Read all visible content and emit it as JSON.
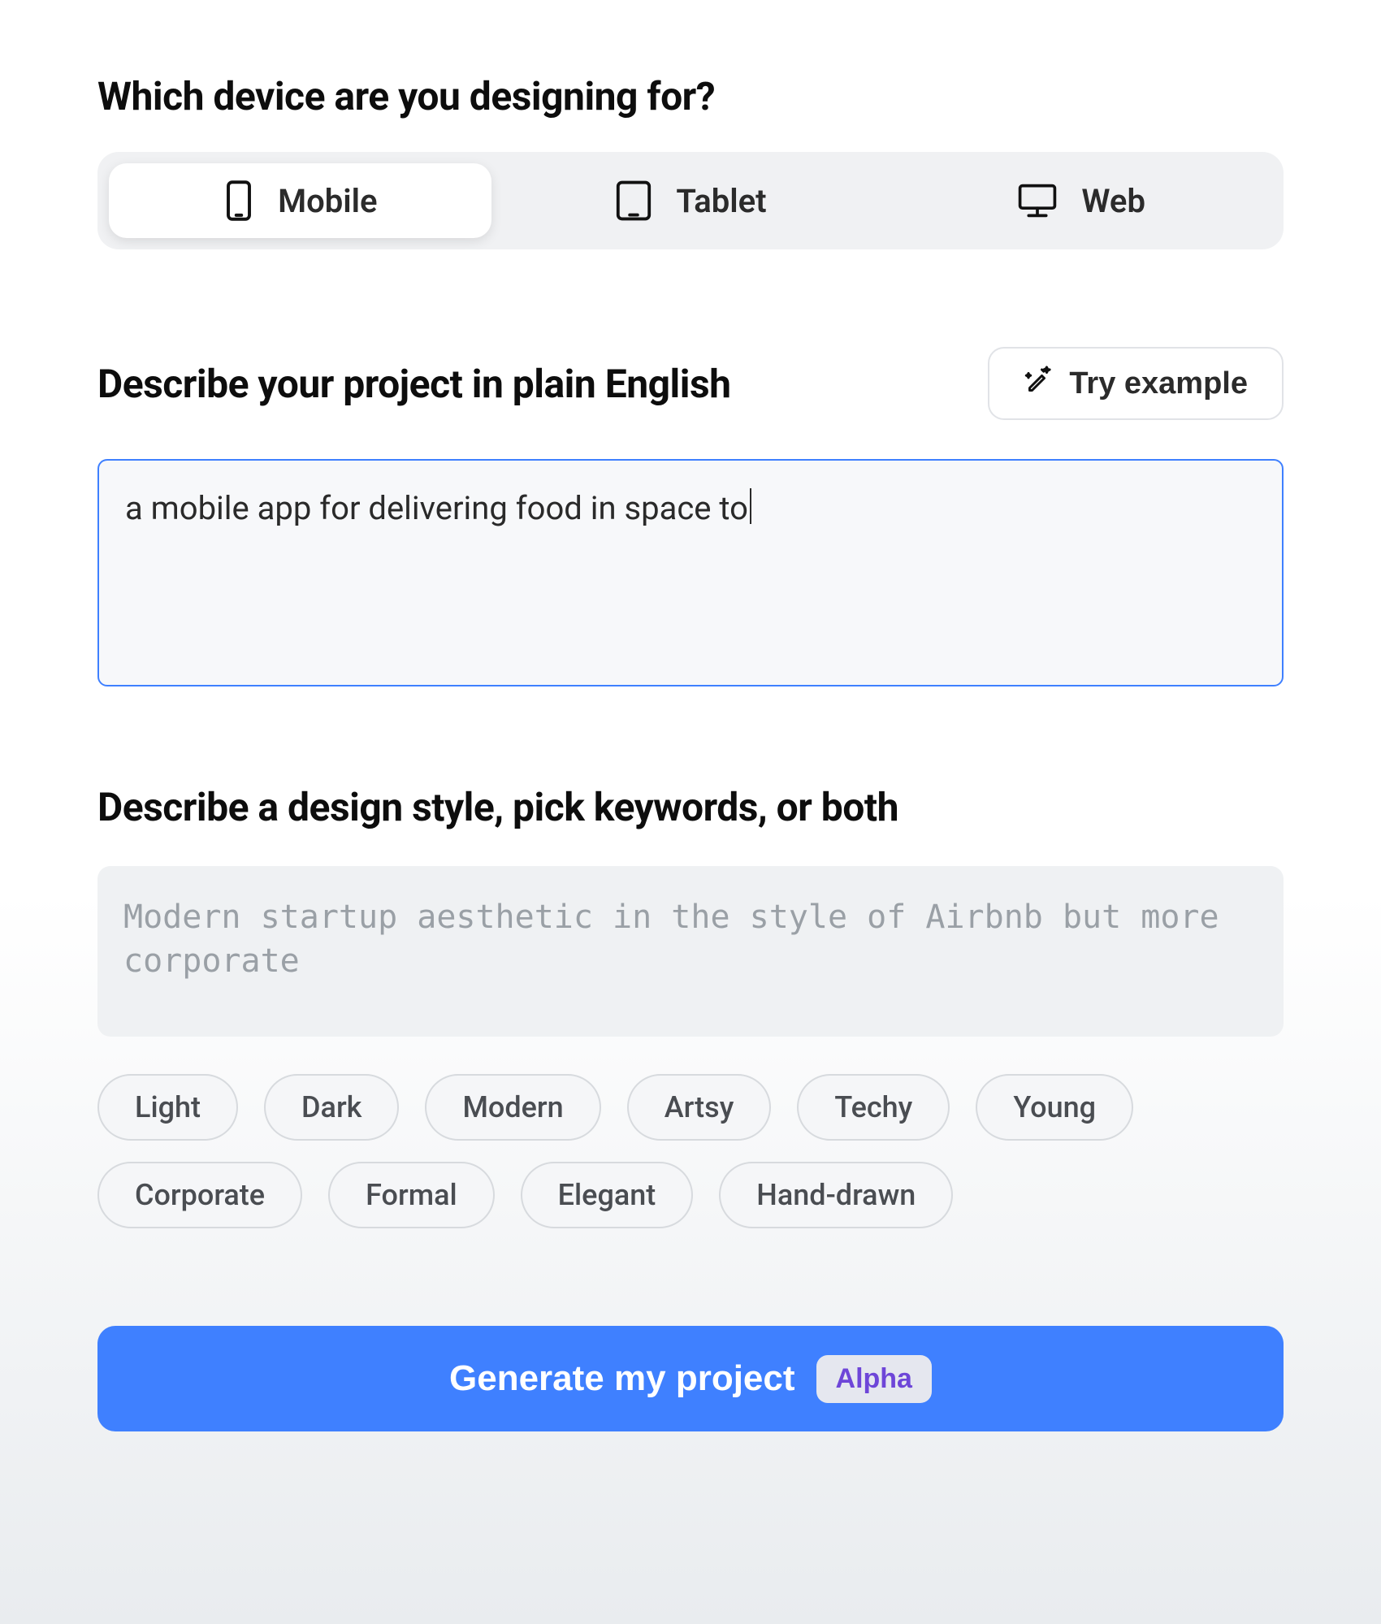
{
  "device_section": {
    "heading": "Which device are you designing for?",
    "options": [
      {
        "id": "mobile",
        "label": "Mobile",
        "icon": "mobile-icon",
        "selected": true
      },
      {
        "id": "tablet",
        "label": "Tablet",
        "icon": "tablet-icon",
        "selected": false
      },
      {
        "id": "web",
        "label": "Web",
        "icon": "desktop-icon",
        "selected": false
      }
    ]
  },
  "project_section": {
    "heading": "Describe your project in plain English",
    "try_example_label": "Try example",
    "textarea_value": "a mobile app for delivering food in space to",
    "textarea_placeholder": ""
  },
  "style_section": {
    "heading": "Describe a design style, pick keywords, or both",
    "textarea_value": "",
    "textarea_placeholder": "Modern startup aesthetic in the style of Airbnb but more corporate",
    "keywords": [
      "Light",
      "Dark",
      "Modern",
      "Artsy",
      "Techy",
      "Young",
      "Corporate",
      "Formal",
      "Elegant",
      "Hand-drawn"
    ]
  },
  "cta": {
    "label": "Generate my project",
    "badge": "Alpha"
  },
  "colors": {
    "accent": "#3f80ff",
    "badge_text": "#6e46d8"
  }
}
